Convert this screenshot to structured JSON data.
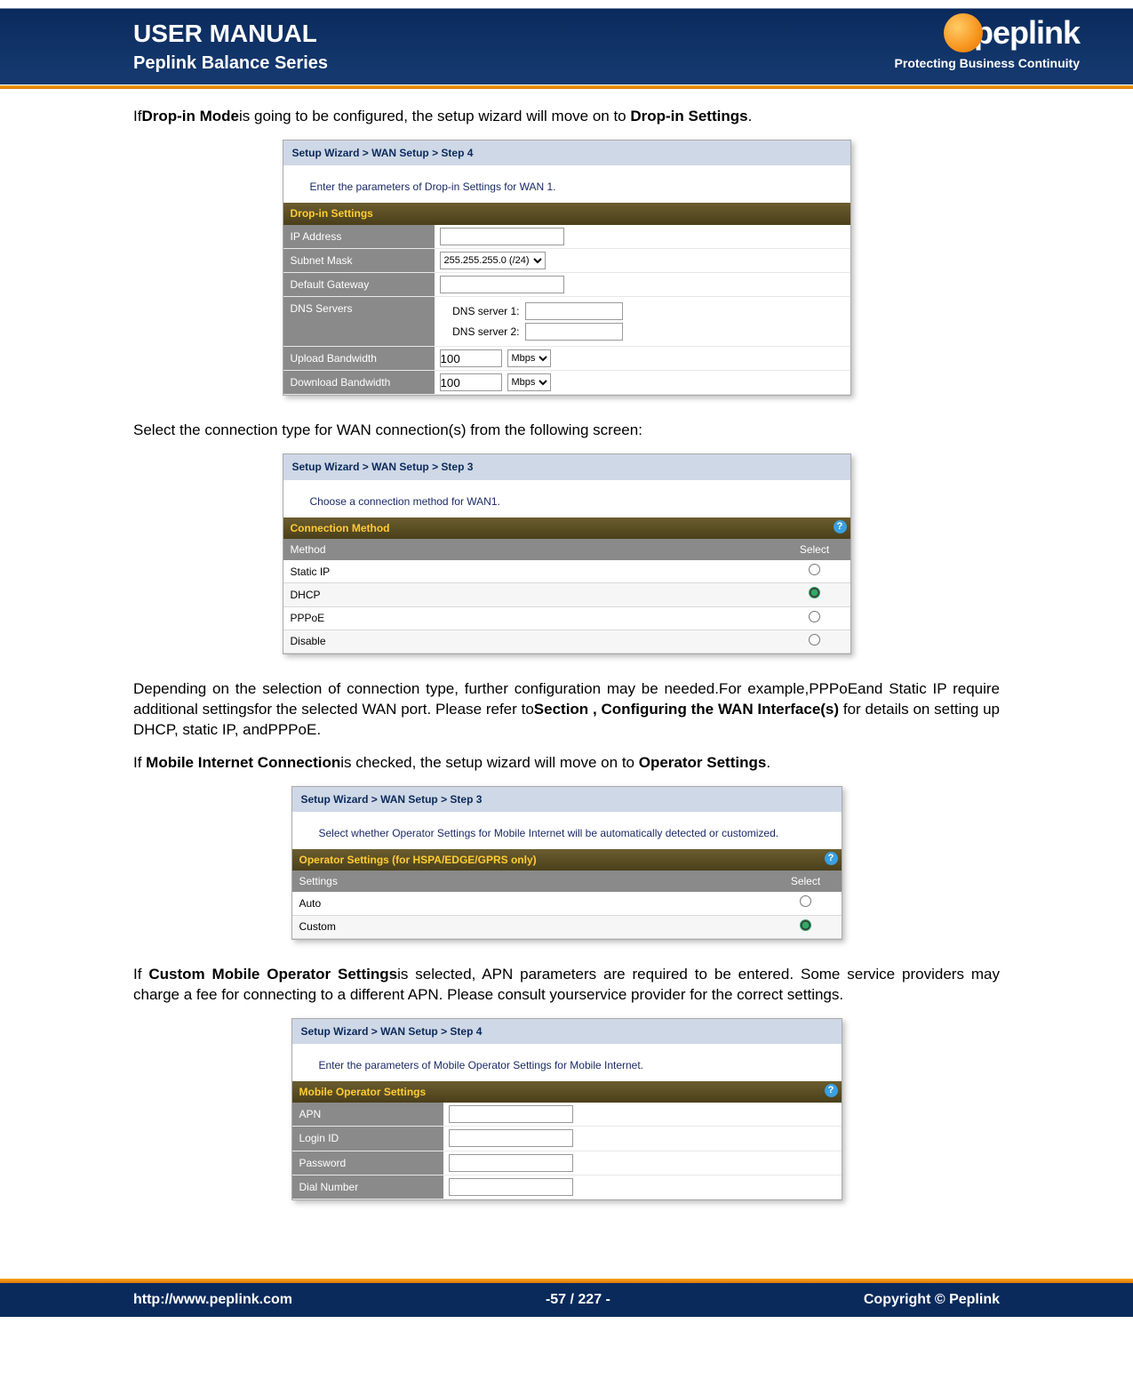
{
  "header": {
    "title": "USER MANUAL",
    "subtitle": "Peplink Balance Series",
    "brand": "peplink",
    "tagline": "Protecting Business Continuity"
  },
  "intro1_a": "If",
  "intro1_b": "Drop-in Mode",
  "intro1_c": "is going to be configured, the setup wizard will move on to ",
  "intro1_d": "Drop-in Settings",
  "intro1_e": ".",
  "fig1": {
    "bread": "Setup Wizard > WAN Setup > Step 4",
    "instr": "Enter the parameters of Drop-in Settings for WAN 1.",
    "section": "Drop-in Settings",
    "rows": {
      "ip": "IP Address",
      "mask": "Subnet Mask",
      "mask_val": "255.255.255.0 (/24)",
      "gw": "Default Gateway",
      "dns": "DNS Servers",
      "dns1": "DNS server 1:",
      "dns2": "DNS server 2:",
      "up": "Upload Bandwidth",
      "up_val": "100",
      "up_unit": "Mbps",
      "dn": "Download Bandwidth",
      "dn_val": "100",
      "dn_unit": "Mbps"
    }
  },
  "intro2": "Select the connection type for WAN connection(s) from the following screen:",
  "fig2": {
    "bread": "Setup Wizard > WAN Setup > Step 3",
    "instr": "Choose a connection method for WAN1.",
    "section": "Connection Method",
    "th_method": "Method",
    "th_select": "Select",
    "rows": [
      "Static IP",
      "DHCP",
      "PPPoE",
      "Disable"
    ],
    "checked_index": 1
  },
  "para3_a": "Depending on the selection of connection type, further configuration may be needed.For example,PPPoEand Static IP require additional settingsfor the selected WAN port. Please refer to",
  "para3_b": "Section , Configuring the WAN Interface(s)",
  "para3_c": " for details on setting up DHCP, static IP, andPPPoE.",
  "para4_a": "If ",
  "para4_b": "Mobile Internet Connection",
  "para4_c": "is checked, the setup wizard will move on to ",
  "para4_d": "Operator Settings",
  "para4_e": ".",
  "fig3": {
    "bread": "Setup Wizard > WAN Setup > Step 3",
    "instr": "Select whether Operator Settings for Mobile Internet will be automatically detected or customized.",
    "section": "Operator Settings (for HSPA/EDGE/GPRS only)",
    "th_settings": "Settings",
    "th_select": "Select",
    "rows": [
      "Auto",
      "Custom"
    ],
    "checked_index": 1
  },
  "para5_a": "If ",
  "para5_b": "Custom Mobile Operator Settings",
  "para5_c": "is selected, APN parameters are required to be entered. Some service providers may charge a fee for connecting to a different APN. Please consult yourservice provider for the correct settings.",
  "fig4": {
    "bread": "Setup Wizard > WAN Setup > Step 4",
    "instr": "Enter the parameters of Mobile Operator Settings for Mobile Internet.",
    "section": "Mobile Operator Settings",
    "rows": [
      "APN",
      "Login ID",
      "Password",
      "Dial Number"
    ]
  },
  "footer": {
    "url": "http://www.peplink.com",
    "page": "-57 / 227 -",
    "copy": "Copyright ©  Peplink"
  }
}
